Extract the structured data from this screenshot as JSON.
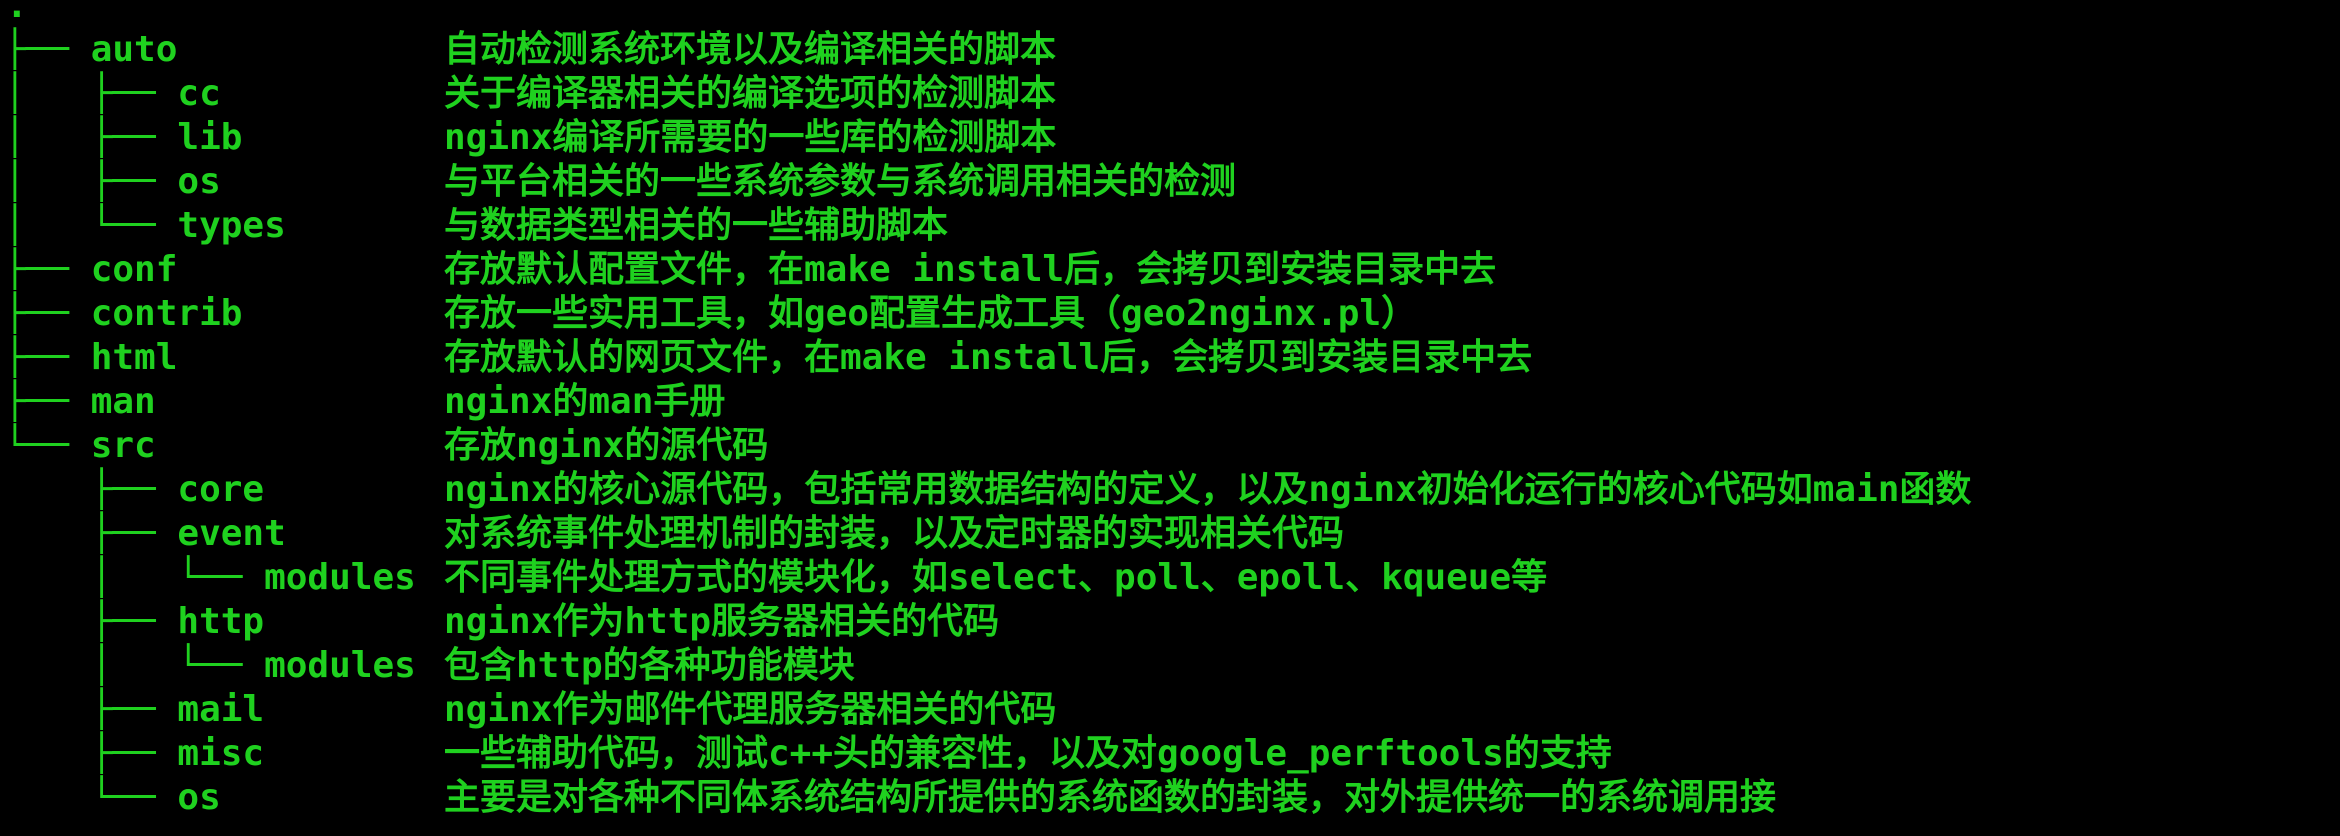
{
  "terminal": {
    "root": ".",
    "rows": [
      {
        "tree": "├── auto",
        "desc": "自动检测系统环境以及编译相关的脚本"
      },
      {
        "tree": "│   ├── cc",
        "desc": "关于编译器相关的编译选项的检测脚本"
      },
      {
        "tree": "│   ├── lib",
        "desc": "nginx编译所需要的一些库的检测脚本"
      },
      {
        "tree": "│   ├── os",
        "desc": "与平台相关的一些系统参数与系统调用相关的检测"
      },
      {
        "tree": "│   └── types",
        "desc": "与数据类型相关的一些辅助脚本"
      },
      {
        "tree": "├── conf",
        "desc": "存放默认配置文件，在make install后，会拷贝到安装目录中去"
      },
      {
        "tree": "├── contrib",
        "desc": "存放一些实用工具，如geo配置生成工具（geo2nginx.pl）"
      },
      {
        "tree": "├── html",
        "desc": "存放默认的网页文件，在make install后，会拷贝到安装目录中去"
      },
      {
        "tree": "├── man",
        "desc": "nginx的man手册"
      },
      {
        "tree": "└── src",
        "desc": "存放nginx的源代码"
      },
      {
        "tree": "    ├── core",
        "desc": "nginx的核心源代码，包括常用数据结构的定义，以及nginx初始化运行的核心代码如main函数"
      },
      {
        "tree": "    ├── event",
        "desc": "对系统事件处理机制的封装，以及定时器的实现相关代码"
      },
      {
        "tree": "    │   └── modules",
        "desc": "不同事件处理方式的模块化，如select、poll、epoll、kqueue等"
      },
      {
        "tree": "    ├── http",
        "desc": "nginx作为http服务器相关的代码"
      },
      {
        "tree": "    │   └── modules",
        "desc": "包含http的各种功能模块"
      },
      {
        "tree": "    ├── mail",
        "desc": "nginx作为邮件代理服务器相关的代码"
      },
      {
        "tree": "    ├── misc",
        "desc": "一些辅助代码，测试c++头的兼容性，以及对google_perftools的支持"
      },
      {
        "tree": "    └── os",
        "desc": "主要是对各种不同体系统结构所提供的系统函数的封装，对外提供统一的系统调用接"
      }
    ],
    "colors": {
      "background": "#000000",
      "text": "#1fd11f"
    }
  }
}
